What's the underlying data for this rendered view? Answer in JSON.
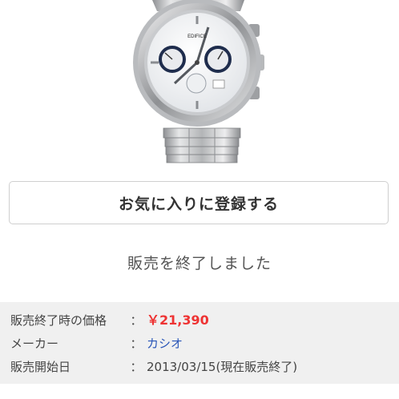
{
  "product": {
    "image_alt": "watch",
    "brand_mark": "EDIFICE"
  },
  "favorite_button": {
    "label": "お気に入りに登録する"
  },
  "sold_message": "販売を終了しました",
  "details": {
    "price": {
      "label": "販売終了時の価格",
      "sep": "：",
      "value": "￥21,390"
    },
    "maker": {
      "label": "メーカー",
      "sep": "：",
      "value": "カシオ"
    },
    "release": {
      "label": "販売開始日",
      "sep": "：",
      "value": "2013/03/15(現在販売終了)"
    }
  },
  "colors": {
    "price": "#e33333",
    "link": "#2a56b8",
    "info_bg": "#f0f0f0"
  }
}
